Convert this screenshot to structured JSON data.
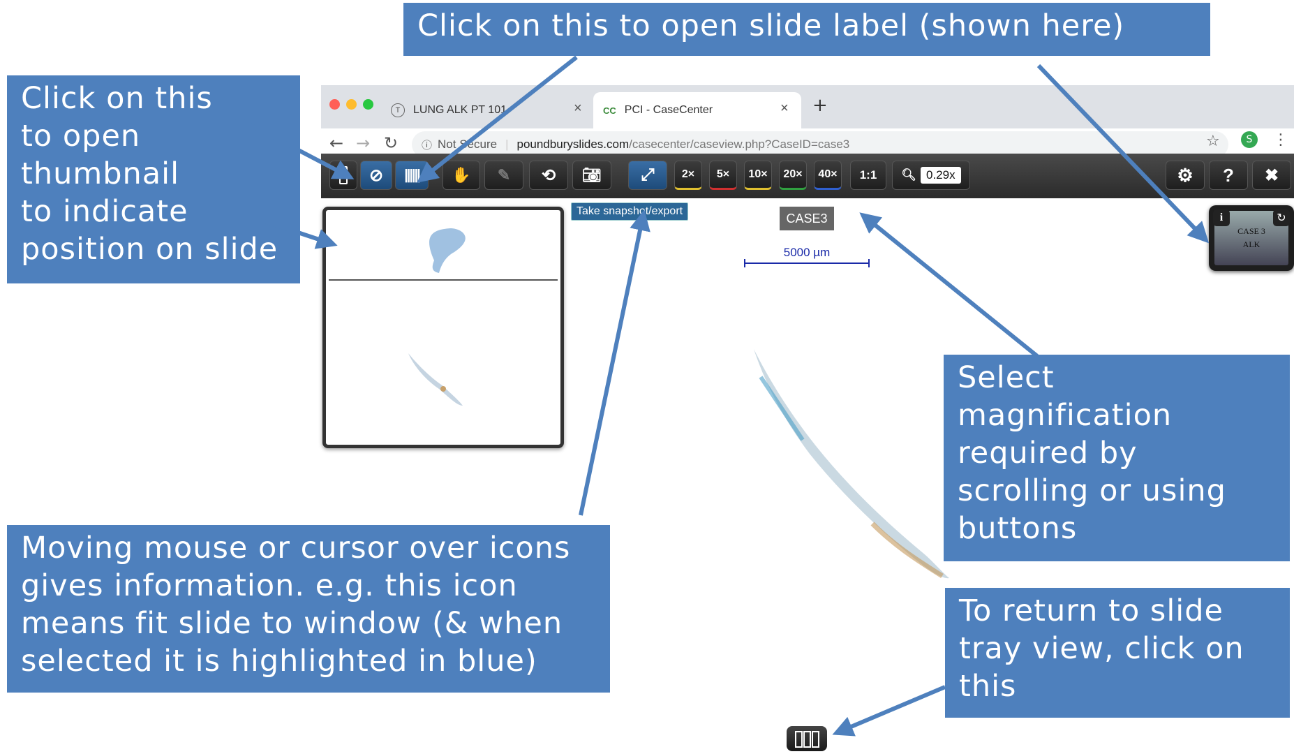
{
  "browser": {
    "tabs": [
      {
        "label": "LUNG ALK PT 101",
        "icon": "T"
      },
      {
        "label": "PCI - CaseCenter",
        "icon": "CC"
      }
    ],
    "new_tab": "+",
    "close": "×",
    "url_security": "Not Secure",
    "url_host": "poundburyslides.com",
    "url_path": "/casecenter/caseview.php?CaseID=case3",
    "profile_initial": "S"
  },
  "toolbar": {
    "magnifications": [
      "2×",
      "5×",
      "10×",
      "20×",
      "40×"
    ],
    "one_to_one": "1:1",
    "zoom_value": "0.29x"
  },
  "viewer": {
    "tooltip": "Take snapshot/export",
    "case_label": "CASE3",
    "scale_label": "5000 µm",
    "slide_label_lines": [
      "CASE 3",
      "ALK"
    ]
  },
  "callouts": {
    "top": "Click on this to open slide label (shown here)",
    "left": [
      "Click on this",
      "to open",
      "thumbnail",
      "to indicate",
      "position on slide"
    ],
    "right_mid": [
      "Select",
      "magnification",
      "required by",
      "scrolling or using",
      "buttons"
    ],
    "bottom_left": [
      "Moving mouse or cursor over icons",
      "gives information. e.g. this icon",
      "means fit slide to window (& when",
      "selected it is highlighted in blue)"
    ],
    "bottom_right": [
      "To return to slide",
      "tray view, click on",
      "this"
    ]
  },
  "colors": {
    "callout": "#4e80bd",
    "toolbar": "#2b2b2b",
    "highlight": "#2c6797"
  }
}
